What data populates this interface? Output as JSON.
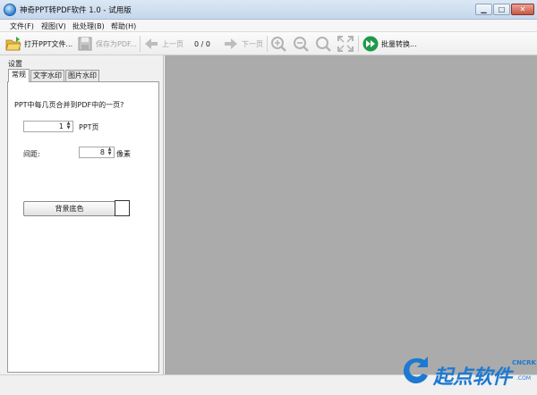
{
  "window": {
    "title": "神奇PPT转PDF软件 1.0 - 试用版",
    "min": "▁",
    "max": "□",
    "close": "✕"
  },
  "menu": [
    {
      "label": "文件(F)"
    },
    {
      "label": "视图(V)"
    },
    {
      "label": "批处理(B)"
    },
    {
      "label": "帮助(H)"
    }
  ],
  "toolbar": {
    "open_label": "打开PPT文件...",
    "save_label": "保存为PDF...",
    "prev_label": "上一页",
    "page_counter": "0 / 0",
    "next_label": "下一页",
    "batch_label": "批量转换..."
  },
  "settings": {
    "title": "设置",
    "tabs": [
      {
        "label": "常规"
      },
      {
        "label": "文字水印"
      },
      {
        "label": "图片水印"
      }
    ],
    "question": "PPT中每几页合并到PDF中的一页?",
    "pages_value": "1",
    "pages_unit": "PPT页",
    "spacing_label": "间距:",
    "spacing_value": "8",
    "spacing_unit": "像素",
    "bg_button": "背景底色",
    "bg_color": "#ffffff"
  },
  "watermark": {
    "brand": "起点软件",
    "sub": "CNCRK",
    "domain": ".COM"
  },
  "colors": {
    "preview_bg": "#ababab",
    "accent": "#1d79d1"
  }
}
